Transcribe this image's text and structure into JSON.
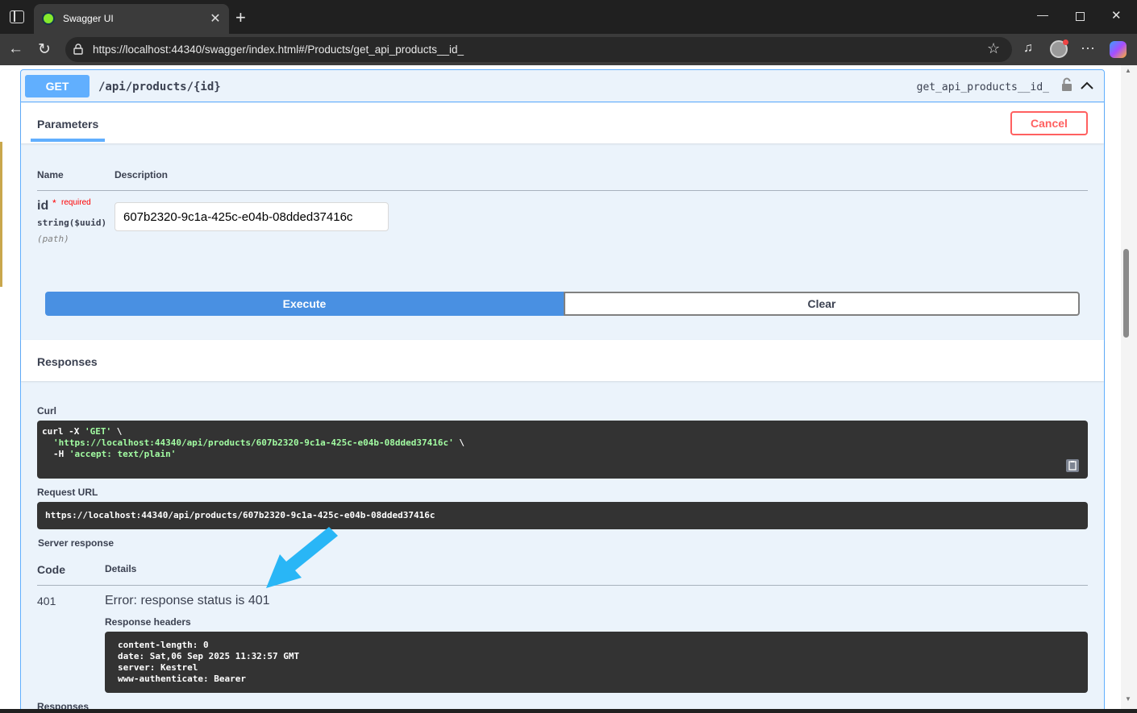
{
  "browser": {
    "tab_title": "Swagger UI",
    "url": "https://localhost:44340/swagger/index.html#/Products/get_api_products__id_"
  },
  "operation": {
    "method": "GET",
    "path": "/api/products/{id}",
    "operation_id": "get_api_products__id_"
  },
  "parameters": {
    "tab_label": "Parameters",
    "cancel_label": "Cancel",
    "col_name": "Name",
    "col_description": "Description",
    "param_name": "id",
    "required_star": "*",
    "required_label": "required",
    "param_type": "string($uuid)",
    "param_in": "(path)",
    "param_value": "607b2320-9c1a-425c-e04b-08dded37416c"
  },
  "actions": {
    "execute_label": "Execute",
    "clear_label": "Clear"
  },
  "responses": {
    "title": "Responses",
    "curl_label": "Curl",
    "curl_line1_cmd": "curl -X ",
    "curl_line1_method": "'GET'",
    "curl_line1_end": " \\",
    "curl_line2_url": "'https://localhost:44340/api/products/607b2320-9c1a-425c-e04b-08dded37416c'",
    "curl_line2_end": " \\",
    "curl_line3_flag": "-H ",
    "curl_line3_header": "'accept: text/plain'",
    "request_url_label": "Request URL",
    "request_url": "https://localhost:44340/api/products/607b2320-9c1a-425c-e04b-08dded37416c",
    "server_response_label": "Server response",
    "col_code": "Code",
    "col_details": "Details",
    "code": "401",
    "error_text": "Error: response status is 401",
    "headers_label": "Response headers",
    "headers": [
      "content-length: 0",
      "date: Sat,06 Sep 2025 11:32:57 GMT",
      "server: Kestrel",
      "www-authenticate: Bearer"
    ],
    "bottom_label": "Responses"
  },
  "colors": {
    "get_blue": "#61affe",
    "execute_blue": "#4990e2",
    "cancel_red": "#ff6060",
    "annotation_arrow": "#29b6f6"
  }
}
